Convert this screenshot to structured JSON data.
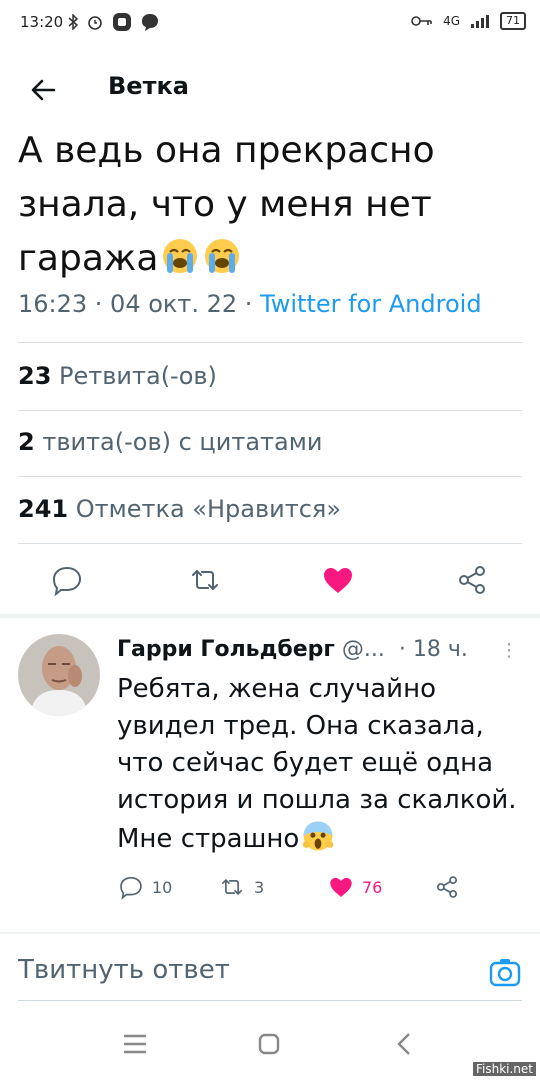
{
  "status_bar": {
    "time": "13:20",
    "network": "4G",
    "battery": "71"
  },
  "header": {
    "title": "Ветка"
  },
  "tweet": {
    "text": "А ведь она прекрасно знала, что у меня нет гаража",
    "emojis": [
      "crying-face-emoji",
      "crying-face-emoji"
    ],
    "time": "16:23 · 04 окт. 22 · ",
    "source": "Twitter for Android",
    "stats": {
      "retweets_count": "23",
      "retweets_label": "Ретвита(-ов)",
      "quotes_count": "2",
      "quotes_label": "твита(-ов) с цитатами",
      "likes_count": "241",
      "likes_label": "Отметка «Нравится»"
    },
    "actions": [
      "reply-icon",
      "retweet-icon",
      "like-icon",
      "share-icon"
    ],
    "like_color": "#f91880"
  },
  "reply": {
    "name": "Гарри Гольдберг",
    "handle": "@...",
    "dot": "·",
    "ago": "18 ч.",
    "text": "Ребята, жена случайно увидел тред. Она сказала, что сейчас будет ещё одна история и пошла за скалкой. Мне страшно",
    "emoji": "screaming-face-emoji",
    "replies": "10",
    "retweets": "3",
    "likes": "76"
  },
  "compose": {
    "placeholder": "Твитнуть ответ"
  },
  "watermark": "Fishki.net",
  "colors": {
    "accent": "#1d9bf0",
    "text": "#0f1419",
    "muted": "#536471",
    "like": "#f91880"
  }
}
